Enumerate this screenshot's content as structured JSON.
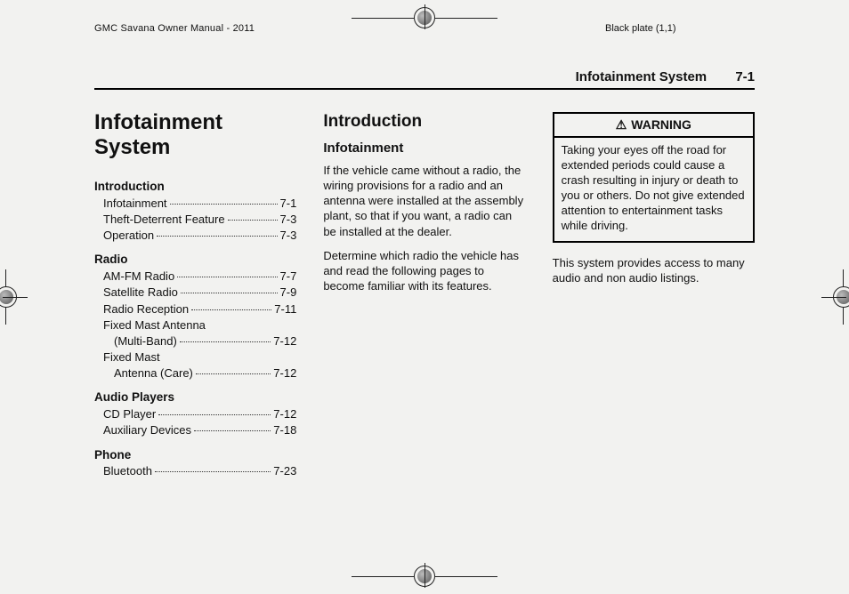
{
  "meta": {
    "manual_title": "GMC Savana Owner Manual - 2011",
    "plate_text": "Black plate (1,1)"
  },
  "running_head": {
    "section": "Infotainment System",
    "page": "7-1"
  },
  "col1": {
    "chapter_title_line1": "Infotainment",
    "chapter_title_line2": "System",
    "toc": {
      "introduction": {
        "head": "Introduction",
        "items": [
          {
            "label": "Infotainment",
            "pg": "7-1"
          },
          {
            "label": "Theft-Deterrent Feature",
            "pg": "7-3"
          },
          {
            "label": "Operation",
            "pg": "7-3"
          }
        ]
      },
      "radio": {
        "head": "Radio",
        "items": [
          {
            "label": "AM-FM Radio",
            "pg": "7-7"
          },
          {
            "label": "Satellite Radio",
            "pg": "7-9"
          },
          {
            "label": "Radio Reception",
            "pg": "7-11"
          },
          {
            "label": "Fixed Mast Antenna",
            "label2": "(Multi-Band)",
            "pg": "7-12"
          },
          {
            "label": "Fixed Mast",
            "label2": "Antenna (Care)",
            "pg": "7-12"
          }
        ]
      },
      "audio": {
        "head": "Audio Players",
        "items": [
          {
            "label": "CD Player",
            "pg": "7-12"
          },
          {
            "label": "Auxiliary Devices",
            "pg": "7-18"
          }
        ]
      },
      "phone": {
        "head": "Phone",
        "items": [
          {
            "label": "Bluetooth",
            "pg": "7-23"
          }
        ]
      }
    }
  },
  "col2": {
    "h2": "Introduction",
    "h3": "Infotainment",
    "p1": "If the vehicle came without a radio, the wiring provisions for a radio and an antenna were installed at the assembly plant, so that if you want, a radio can be installed at the dealer.",
    "p2": "Determine which radio the vehicle has and read the following pages to become familiar with its features."
  },
  "col3": {
    "warning": {
      "title": "WARNING",
      "icon": "⚠",
      "body": "Taking your eyes off the road for extended periods could cause a crash resulting in injury or death to you or others. Do not give extended attention to entertainment tasks while driving."
    },
    "p1": "This system provides access to many audio and non audio listings."
  }
}
